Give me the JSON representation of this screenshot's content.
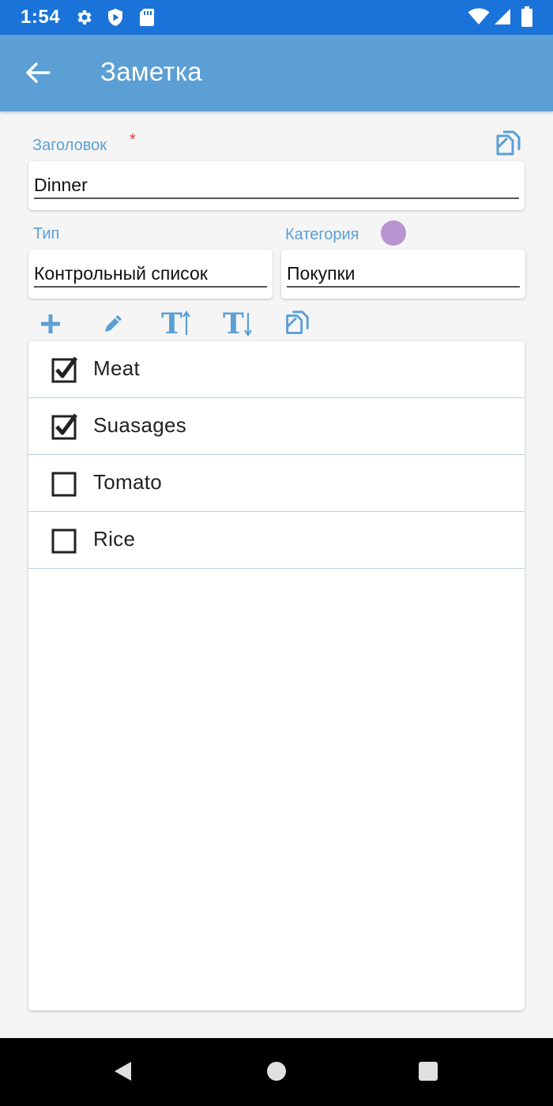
{
  "status_bar": {
    "time": "1:54",
    "icons": [
      "gear-icon",
      "shield-icon",
      "sd-card-icon",
      "wifi-icon",
      "cell-signal-icon",
      "battery-icon"
    ],
    "color": "#1a73d9"
  },
  "appbar": {
    "title": "Заметка",
    "back_icon": "arrow-left-icon",
    "color": "#5b9fd4"
  },
  "form": {
    "title_label": "Заголовок",
    "title_required": "*",
    "title_value": "Dinner",
    "type_label": "Тип",
    "type_value": "Контрольный список",
    "category_label": "Категория",
    "category_value": "Покупки",
    "category_color": "#b794d0",
    "accent_color": "#5b9fd4"
  },
  "toolbar": {
    "icons": [
      "plus-icon",
      "pencil-icon",
      "sort-ascending-icon",
      "sort-descending-icon",
      "copy-icon"
    ]
  },
  "checklist": {
    "items": [
      {
        "label": "Meat",
        "checked": true
      },
      {
        "label": "Suasages",
        "checked": true
      },
      {
        "label": "Tomato",
        "checked": false
      },
      {
        "label": "Rice",
        "checked": false
      }
    ]
  },
  "nav_bar": {
    "icons": [
      "back-triangle-icon",
      "home-circle-icon",
      "recents-square-icon"
    ]
  }
}
